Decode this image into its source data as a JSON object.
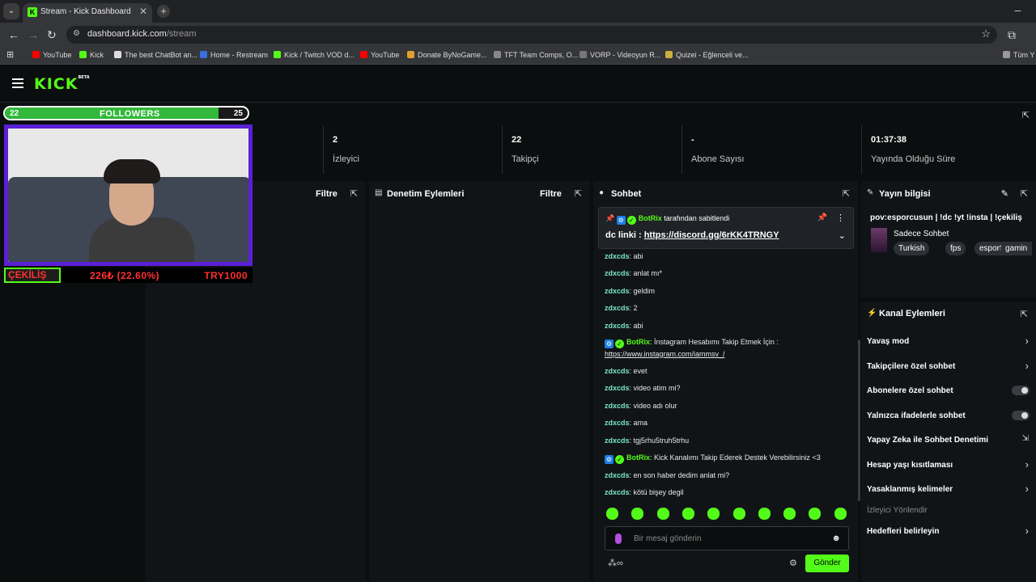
{
  "browser": {
    "tab_title": "Stream - Kick Dashboard",
    "url_host": "dashboard.kick.com",
    "url_path": "/stream",
    "bookmarks": [
      "YouTube",
      "Kick",
      "The best ChatBot an...",
      "Home - Restream",
      "Kick / Twitch VOD d...",
      "YouTube",
      "Donate ByNoGame...",
      "TFT Team Comps, O...",
      "VORP - Videoyun R...",
      "Quizei - Eğlenceli ve...",
      "Tüm Y"
    ]
  },
  "app": {
    "logo": "KICK",
    "logo_tag": "BETA"
  },
  "stats": [
    {
      "value": "2",
      "label": "İzleyici"
    },
    {
      "value": "22",
      "label": "Takipçi"
    },
    {
      "value": "-",
      "label": "Abone Sayısı"
    },
    {
      "value": "01:37:38",
      "label": "Yayında Olduğu Süre"
    }
  ],
  "panels": {
    "filter_label": "Filtre",
    "moderation_title": "Denetim Eylemleri",
    "chat_title": "Sohbet",
    "stream_info_title": "Yayın bilgisi",
    "channel_actions_title": "Kanal Eylemleri"
  },
  "chat": {
    "pinned_by": "BotRix",
    "pinned_suffix": "tarafından sabitlendi",
    "pinned_label": "dc linki : ",
    "pinned_link": "https://discord.gg/6rKK4TRNGY",
    "messages": [
      {
        "user": "zdxcds",
        "text": "abi"
      },
      {
        "user": "zdxcds",
        "text": "anlat mı*"
      },
      {
        "user": "zdxcds",
        "text": "geldim"
      },
      {
        "user": "zdxcds",
        "text": "2"
      },
      {
        "user": "zdxcds",
        "text": "abi"
      },
      {
        "user": "BotRix",
        "text": "İnstagram Hesabımı Takip Etmek İçin :",
        "link": "https://www.instagram.com/iammsv_/"
      },
      {
        "user": "zdxcds",
        "text": "evet"
      },
      {
        "user": "zdxcds",
        "text": "video atim mi?"
      },
      {
        "user": "zdxcds",
        "text": "video adı olur"
      },
      {
        "user": "zdxcds",
        "text": "ama"
      },
      {
        "user": "zdxcds",
        "text": "tgj5rhu5truh5trhu"
      },
      {
        "user": "BotRix",
        "text": "Kick Kanalımı Takip Ederek Destek Verebilirsiniz <3"
      },
      {
        "user": "zdxcds",
        "text": "en son haber dedim anlat mi?"
      },
      {
        "user": "zdxcds",
        "text": "kötü bişey degil"
      }
    ],
    "input_placeholder": "Bir mesaj gönderin",
    "send_label": "Gönder"
  },
  "stream_info": {
    "title": "pov:esporcusun | !dc !yt !insta | !çekiliş",
    "category": "Sadece Sohbet",
    "tags": [
      "Turkish",
      "fps",
      "esports",
      "gamin"
    ]
  },
  "channel_actions": [
    {
      "label": "Yavaş mod",
      "control": "chevron"
    },
    {
      "label": "Takipçilere özel sohbet",
      "control": "chevron"
    },
    {
      "label": "Abonelere özel sohbet",
      "control": "toggle"
    },
    {
      "label": "Yalnızca ifadelerle sohbet",
      "control": "toggle"
    },
    {
      "label": "Yapay Zeka ile Sohbet Denetimi",
      "control": "external"
    },
    {
      "label": "Hesap yaşı kısıtlaması",
      "control": "chevron"
    },
    {
      "label": "Yasaklanmış kelimeler",
      "control": "chevron"
    },
    {
      "label": "İzleyici Yönlendir",
      "control": "none"
    },
    {
      "label": "Hedefleri belirleyin",
      "control": "chevron"
    }
  ],
  "overlay": {
    "followers_current": "22",
    "followers_label": "FOLLOWERS",
    "followers_goal": "25",
    "followers_progress": 0.88,
    "giveaway_label": "ÇEKİLİŞ",
    "giveaway_progress": "226₺ (22.60%)",
    "giveaway_code": "TRY1000"
  },
  "colors": {
    "accent": "#53fc18",
    "purple_frame": "#5b1fd6",
    "alert_red": "#ff3030"
  }
}
